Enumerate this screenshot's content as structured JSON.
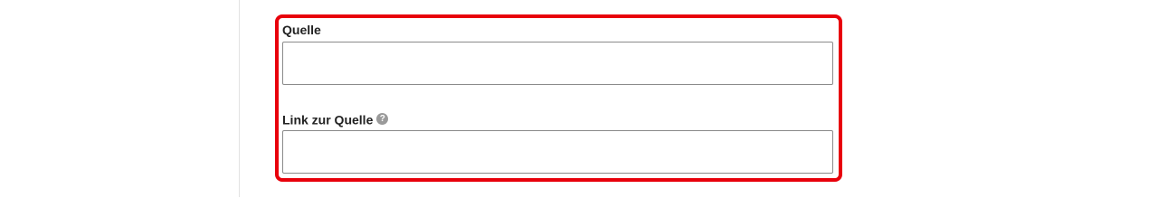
{
  "form": {
    "source": {
      "label": "Quelle",
      "value": "",
      "placeholder": ""
    },
    "source_link": {
      "label": "Link zur Quelle",
      "help_icon_glyph": "?",
      "value": "",
      "placeholder": ""
    }
  },
  "colors": {
    "highlight_border": "#e8000b",
    "help_icon_bg": "#9a9a9a",
    "input_border": "#8a8a8a"
  },
  "icons": {
    "help": "question-circle-icon"
  }
}
